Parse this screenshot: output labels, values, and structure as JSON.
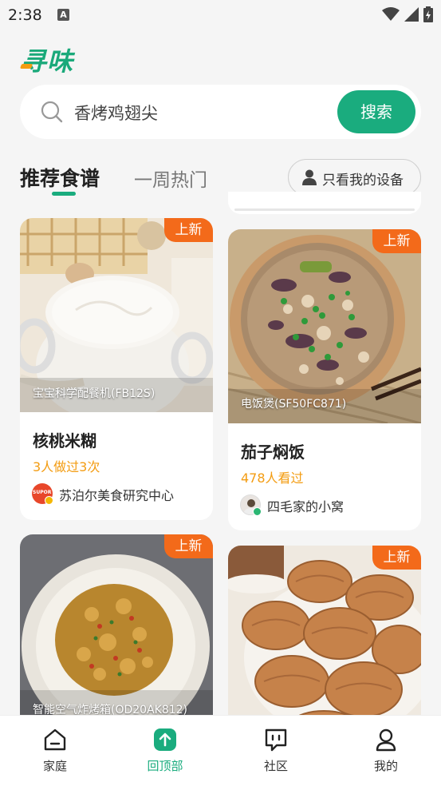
{
  "status_bar": {
    "time": "2:38",
    "notification_letter": "A"
  },
  "app": {
    "logo": "寻味",
    "brand_color": "#1aac7e",
    "accent_color": "#f36a1a"
  },
  "search": {
    "query": "香烤鸡翅尖",
    "button_label": "搜索"
  },
  "tabs": {
    "active": "推荐食谱",
    "inactive": "一周热门",
    "device_filter": "只看我的设备"
  },
  "recipes": [
    {
      "badge": "上新",
      "device": "宝宝科学配餐机(FB12S)",
      "title": "核桃米糊",
      "stat": "3人做过3次",
      "author": "苏泊尔美食研究中心",
      "avatar_text": "SUPOR"
    },
    {
      "badge": "上新",
      "device": "电饭煲(SF50FC871)",
      "title": "茄子焖饭",
      "stat": "478人看过",
      "author": "四毛家的小窝"
    },
    {
      "badge": "上新",
      "device": "智能空气炸烤箱(OD20AK812)"
    },
    {
      "badge": "上新"
    }
  ],
  "bottom_nav": [
    {
      "label": "家庭",
      "icon": "home-icon"
    },
    {
      "label": "回顶部",
      "icon": "back-to-top-icon"
    },
    {
      "label": "社区",
      "icon": "community-icon"
    },
    {
      "label": "我的",
      "icon": "profile-icon"
    }
  ]
}
